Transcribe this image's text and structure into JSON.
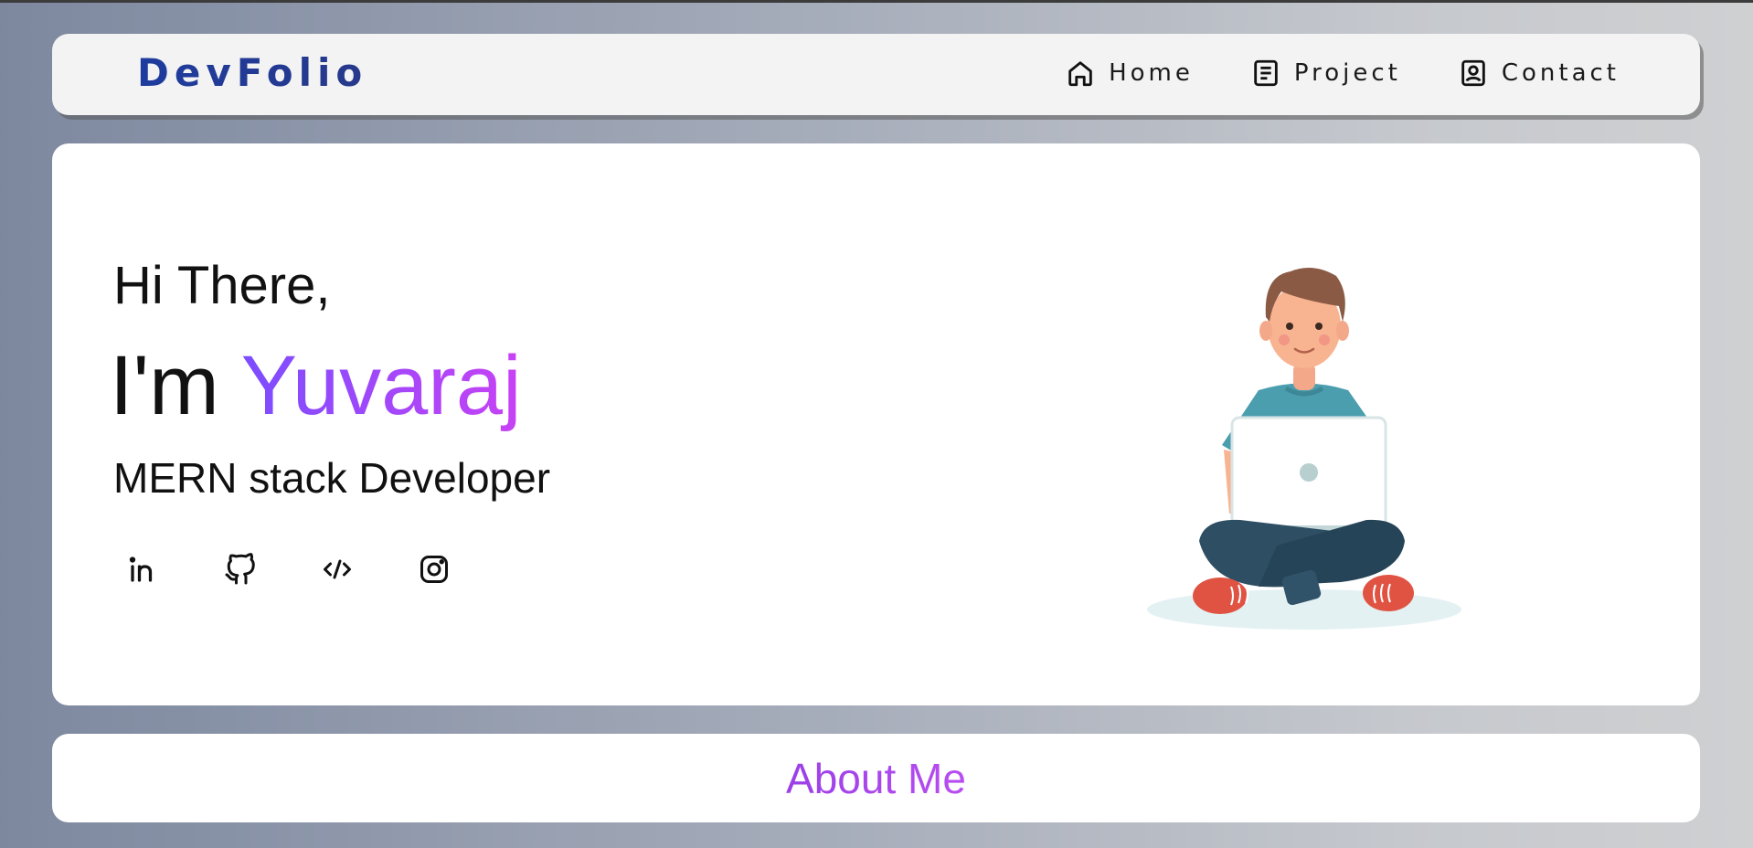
{
  "navbar": {
    "logo": "DevFolio",
    "links": [
      {
        "label": "Home",
        "icon": "home-icon"
      },
      {
        "label": "Project",
        "icon": "document-icon"
      },
      {
        "label": "Contact",
        "icon": "contact-icon"
      }
    ]
  },
  "hero": {
    "greeting": "Hi There,",
    "intro_prefix": "I'm",
    "name": "Yuvaraj",
    "role": "MERN stack Developer",
    "socials": [
      {
        "icon": "linkedin-icon"
      },
      {
        "icon": "github-icon"
      },
      {
        "icon": "code-icon"
      },
      {
        "icon": "instagram-icon"
      }
    ],
    "illustration": "developer-with-laptop-illustration"
  },
  "about": {
    "title": "About Me"
  },
  "colors": {
    "accent_purple": "#a24ef2",
    "logo_blue": "#1e3c9e",
    "card_bg": "#ffffff",
    "navbar_bg": "#f3f3f3"
  }
}
